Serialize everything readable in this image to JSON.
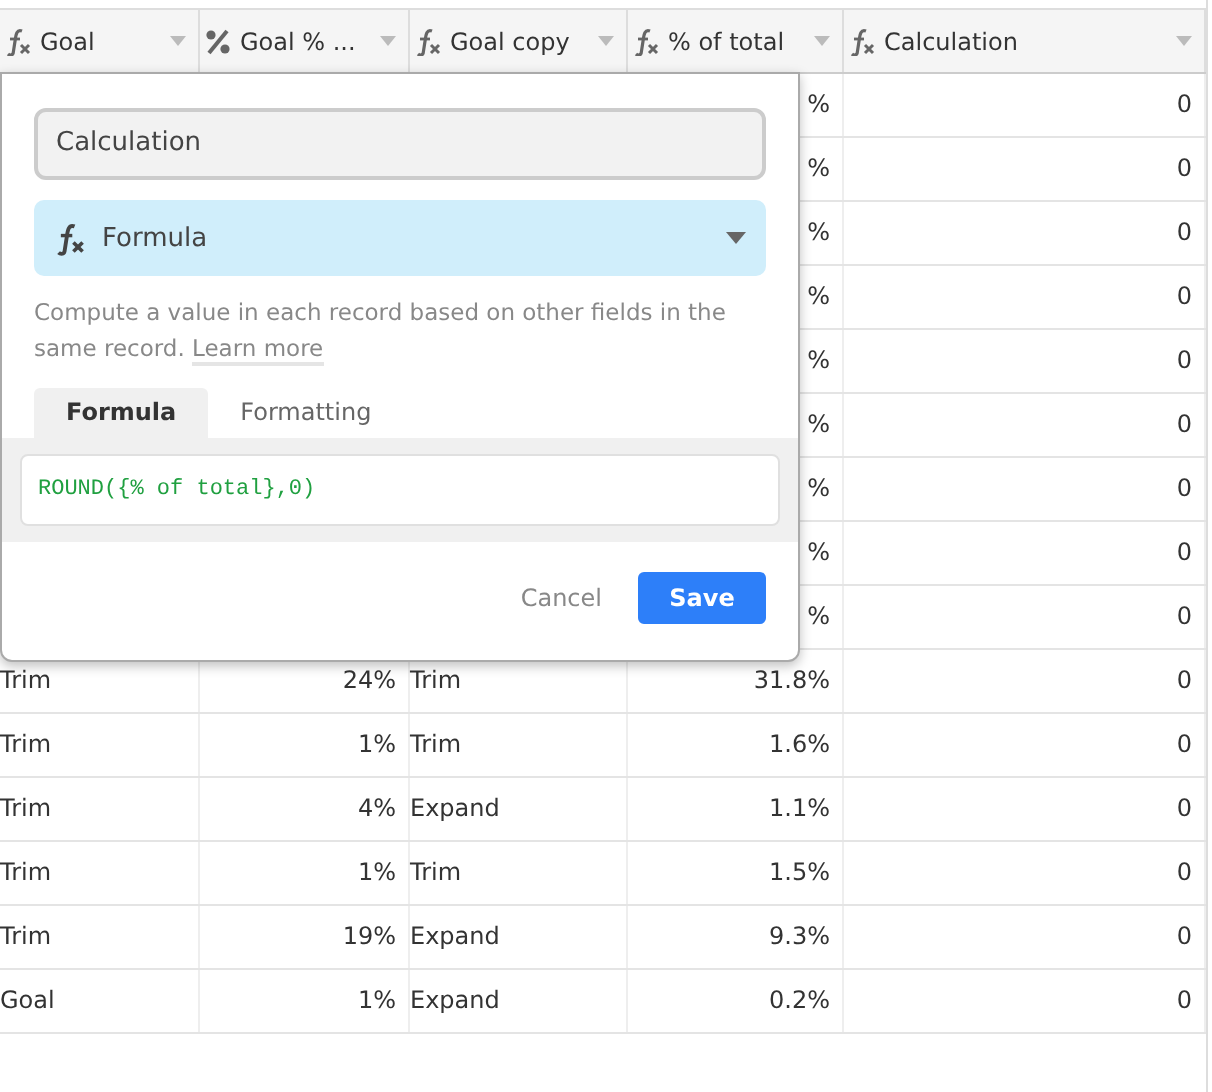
{
  "table": {
    "columns": [
      {
        "label": "Goal",
        "kind": "formula"
      },
      {
        "label": "Goal % ...",
        "kind": "percent"
      },
      {
        "label": "Goal copy",
        "kind": "formula"
      },
      {
        "label": "% of total",
        "kind": "formula"
      },
      {
        "label": "Calculation",
        "kind": "formula"
      }
    ],
    "rows": [
      {
        "cells": [
          "",
          "",
          "",
          "%",
          "0"
        ]
      },
      {
        "cells": [
          "",
          "",
          "",
          "%",
          "0"
        ]
      },
      {
        "cells": [
          "",
          "",
          "",
          "%",
          "0"
        ]
      },
      {
        "cells": [
          "",
          "",
          "",
          "%",
          "0"
        ]
      },
      {
        "cells": [
          "",
          "",
          "",
          "%",
          "0"
        ]
      },
      {
        "cells": [
          "",
          "",
          "",
          "%",
          "0"
        ]
      },
      {
        "cells": [
          "",
          "",
          "",
          "%",
          "0"
        ]
      },
      {
        "cells": [
          "",
          "",
          "",
          "%",
          "0"
        ]
      },
      {
        "cells": [
          "",
          "",
          "",
          "%",
          "0"
        ]
      },
      {
        "cells": [
          "Trim",
          "24%",
          "Trim",
          "31.8%",
          "0"
        ]
      },
      {
        "cells": [
          "Trim",
          "1%",
          "Trim",
          "1.6%",
          "0"
        ]
      },
      {
        "cells": [
          "Trim",
          "4%",
          "Expand",
          "1.1%",
          "0"
        ]
      },
      {
        "cells": [
          "Trim",
          "1%",
          "Trim",
          "1.5%",
          "0"
        ]
      },
      {
        "cells": [
          "Trim",
          "19%",
          "Expand",
          "9.3%",
          "0"
        ]
      },
      {
        "cells": [
          "Goal",
          "1%",
          "Expand",
          "0.2%",
          "0"
        ]
      }
    ]
  },
  "field_editor": {
    "name": "Calculation",
    "type": "Formula",
    "description": "Compute a value in each record based on other fields in the same record.",
    "learn_more": "Learn more",
    "tabs": [
      {
        "label": "Formula",
        "selected": true
      },
      {
        "label": "Formatting",
        "selected": false
      }
    ],
    "formula": "ROUND({% of total},0)",
    "buttons": {
      "cancel": "Cancel",
      "save": "Save"
    }
  }
}
